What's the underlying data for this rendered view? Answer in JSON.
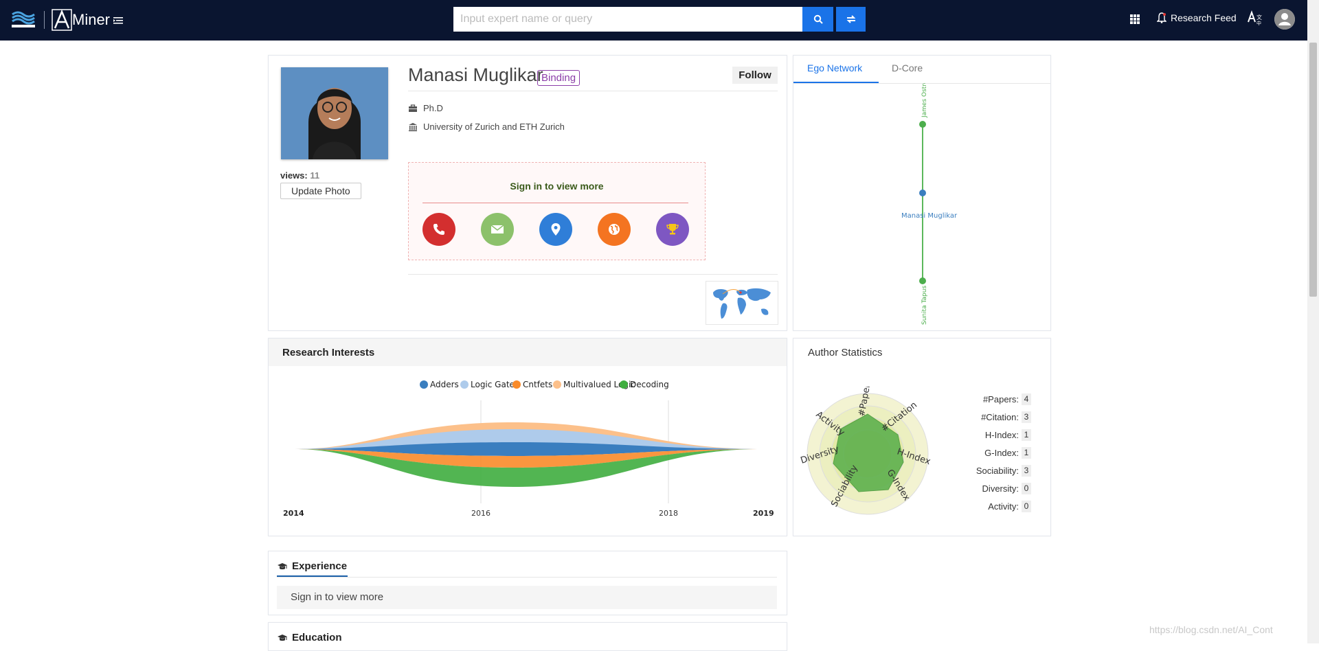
{
  "header": {
    "brand": "Miner",
    "search_placeholder": "Input expert name or query",
    "research_feed": "Research Feed"
  },
  "profile": {
    "name": "Manasi Muglikar",
    "binding_label": "Binding",
    "follow_label": "Follow",
    "views_label": "views:",
    "views_count": "11",
    "update_photo": "Update Photo",
    "position": "Ph.D",
    "affiliation": "University of Zurich and ETH Zurich",
    "sign_in_label": "Sign in to view more"
  },
  "contact_icons": [
    {
      "icon": "phone-icon",
      "color": "#d32f2f"
    },
    {
      "icon": "email-icon",
      "color": "#8cc16b"
    },
    {
      "icon": "location-icon",
      "color": "#2f7ed8"
    },
    {
      "icon": "globe-icon",
      "color": "#f47421"
    },
    {
      "icon": "trophy-icon",
      "color": "#7e57c2"
    }
  ],
  "ego_network": {
    "tabs": [
      "Ego Network",
      "D-Core"
    ],
    "center": "Manasi Muglikar",
    "nodes": [
      "James Ostros",
      "Sunita Tapus"
    ]
  },
  "research_interests": {
    "title": "Research Interests",
    "legend": [
      {
        "name": "Adders",
        "color": "#3a7ebf"
      },
      {
        "name": "Logic Gates",
        "color": "#aecbeb"
      },
      {
        "name": "Cntfets",
        "color": "#f98b2a"
      },
      {
        "name": "Multivalued Logic",
        "color": "#fcc08a"
      },
      {
        "name": "Decoding",
        "color": "#3fad3f"
      }
    ],
    "years": [
      "2014",
      "2016",
      "2018",
      "2019"
    ]
  },
  "chart_data": {
    "type": "area",
    "title": "Research Interests",
    "x": [
      "2014",
      "2016",
      "2018",
      "2019"
    ],
    "series": [
      {
        "name": "Adders",
        "values": [
          0,
          1,
          1,
          0
        ]
      },
      {
        "name": "Logic Gates",
        "values": [
          0,
          1,
          1,
          0
        ]
      },
      {
        "name": "Cntfets",
        "values": [
          0,
          1,
          1,
          0
        ]
      },
      {
        "name": "Multivalued Logic",
        "values": [
          0,
          1,
          1,
          0
        ]
      },
      {
        "name": "Decoding",
        "values": [
          0,
          1,
          1,
          0
        ]
      }
    ]
  },
  "author_statistics": {
    "title": "Author Statistics",
    "radar_axes": [
      "#Papers",
      "#Citation",
      "H-Index",
      "G-Index",
      "Sociability",
      "Diversity",
      "Activity"
    ],
    "rows": [
      {
        "label": "#Papers:",
        "value": "4"
      },
      {
        "label": "#Citation:",
        "value": "3"
      },
      {
        "label": "H-Index:",
        "value": "1"
      },
      {
        "label": "G-Index:",
        "value": "1"
      },
      {
        "label": "Sociability:",
        "value": "3"
      },
      {
        "label": "Diversity:",
        "value": "0"
      },
      {
        "label": "Activity:",
        "value": "0"
      }
    ]
  },
  "experience": {
    "title": "Experience",
    "content": "Sign in to view more"
  },
  "education": {
    "title": "Education"
  },
  "watermark": "https://blog.csdn.net/AI_Cont"
}
